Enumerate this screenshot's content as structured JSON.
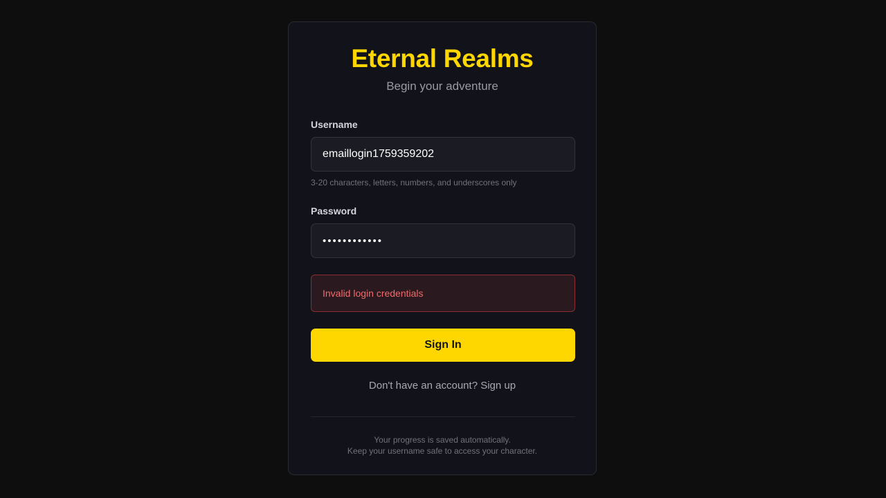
{
  "header": {
    "title": "Eternal Realms",
    "subtitle": "Begin your adventure"
  },
  "form": {
    "username": {
      "label": "Username",
      "value": "emaillogin1759359202",
      "hint": "3-20 characters, letters, numbers, and underscores only"
    },
    "password": {
      "label": "Password",
      "value": "••••••••••••"
    },
    "error": "Invalid login credentials",
    "submit_label": "Sign In"
  },
  "signup": {
    "prompt": "Don't have an account?",
    "link_label": "Sign up"
  },
  "footer": {
    "line1": "Your progress is saved automatically.",
    "line2": "Keep your username safe to access your character."
  },
  "colors": {
    "accent": "#ffd700",
    "error": "#f06b6b",
    "background": "#0e0e0e",
    "card": "#12121a"
  }
}
